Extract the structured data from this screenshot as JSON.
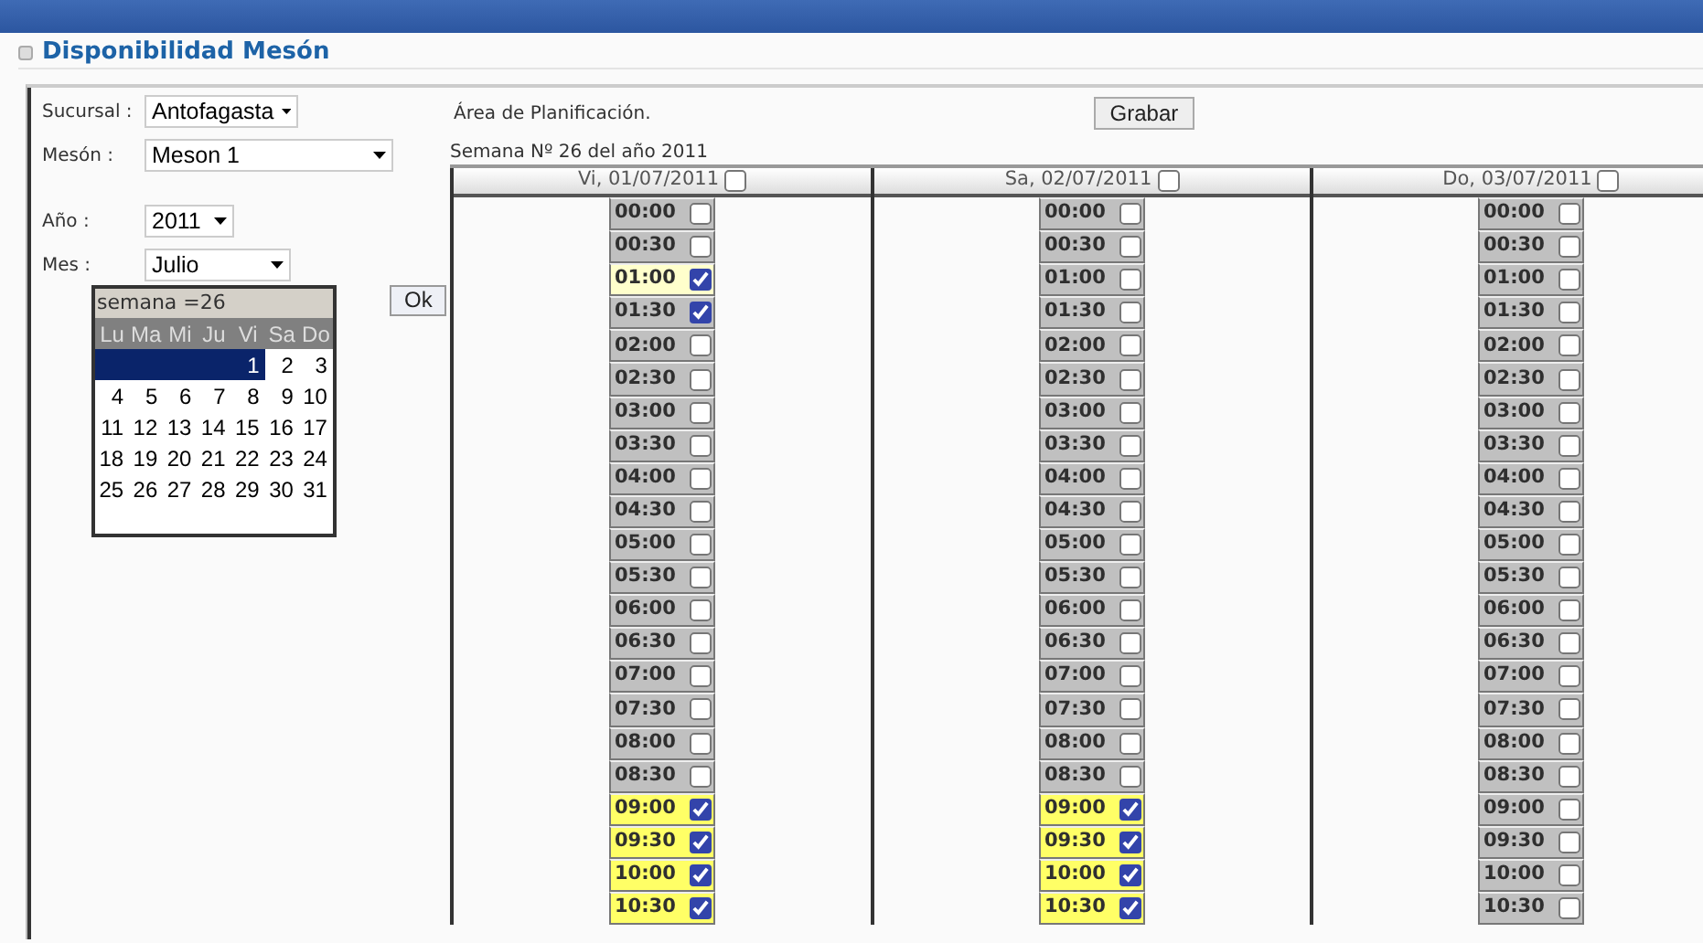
{
  "page_title": "Disponibilidad Mesón",
  "filters": [
    {
      "label": "Sucursal :",
      "value": "Antofagasta"
    },
    {
      "label": "Mesón :",
      "value": "Meson 1"
    },
    {
      "label": "Año :",
      "value": "2011"
    },
    {
      "label": "Mes :",
      "value": "Julio"
    }
  ],
  "calendar": {
    "title": "semana =26",
    "weekdays": [
      "Lu",
      "Ma",
      "Mi",
      "Ju",
      "Vi",
      "Sa",
      "Do"
    ],
    "weeks": [
      {
        "selected": true,
        "days": [
          "1",
          "2",
          "3"
        ]
      },
      {
        "selected": false,
        "days": [
          "4",
          "5",
          "6",
          "7",
          "8",
          "9",
          "10"
        ]
      },
      {
        "selected": false,
        "days": [
          "11",
          "12",
          "13",
          "14",
          "15",
          "16",
          "17"
        ]
      },
      {
        "selected": false,
        "days": [
          "18",
          "19",
          "20",
          "21",
          "22",
          "23",
          "24"
        ]
      },
      {
        "selected": false,
        "days": [
          "25",
          "26",
          "27",
          "28",
          "29",
          "30",
          "31"
        ]
      }
    ]
  },
  "ok_button": "Ok",
  "planning": {
    "title": "Área de Planificación.",
    "save_button": "Grabar",
    "week_label": "Semana Nº 26 del año 2011",
    "days": [
      {
        "header": "Vi, 01/07/2011",
        "checked": false,
        "slots": [
          {
            "time": "00:00",
            "checked": false,
            "selected": false,
            "hovered": false
          },
          {
            "time": "00:30",
            "checked": false,
            "selected": false,
            "hovered": false
          },
          {
            "time": "01:00",
            "checked": true,
            "selected": false,
            "hovered": true
          },
          {
            "time": "01:30",
            "checked": true,
            "selected": false,
            "hovered": false
          },
          {
            "time": "02:00",
            "checked": false,
            "selected": false,
            "hovered": false
          },
          {
            "time": "02:30",
            "checked": false,
            "selected": false,
            "hovered": false
          },
          {
            "time": "03:00",
            "checked": false,
            "selected": false,
            "hovered": false
          },
          {
            "time": "03:30",
            "checked": false,
            "selected": false,
            "hovered": false
          },
          {
            "time": "04:00",
            "checked": false,
            "selected": false,
            "hovered": false
          },
          {
            "time": "04:30",
            "checked": false,
            "selected": false,
            "hovered": false
          },
          {
            "time": "05:00",
            "checked": false,
            "selected": false,
            "hovered": false
          },
          {
            "time": "05:30",
            "checked": false,
            "selected": false,
            "hovered": false
          },
          {
            "time": "06:00",
            "checked": false,
            "selected": false,
            "hovered": false
          },
          {
            "time": "06:30",
            "checked": false,
            "selected": false,
            "hovered": false
          },
          {
            "time": "07:00",
            "checked": false,
            "selected": false,
            "hovered": false
          },
          {
            "time": "07:30",
            "checked": false,
            "selected": false,
            "hovered": false
          },
          {
            "time": "08:00",
            "checked": false,
            "selected": false,
            "hovered": false
          },
          {
            "time": "08:30",
            "checked": false,
            "selected": false,
            "hovered": false
          },
          {
            "time": "09:00",
            "checked": true,
            "selected": true,
            "hovered": false
          },
          {
            "time": "09:30",
            "checked": true,
            "selected": true,
            "hovered": false
          },
          {
            "time": "10:00",
            "checked": true,
            "selected": true,
            "hovered": false
          },
          {
            "time": "10:30",
            "checked": true,
            "selected": true,
            "hovered": false
          }
        ]
      },
      {
        "header": "Sa, 02/07/2011",
        "checked": false,
        "slots": [
          {
            "time": "00:00",
            "checked": false,
            "selected": false,
            "hovered": false
          },
          {
            "time": "00:30",
            "checked": false,
            "selected": false,
            "hovered": false
          },
          {
            "time": "01:00",
            "checked": false,
            "selected": false,
            "hovered": false
          },
          {
            "time": "01:30",
            "checked": false,
            "selected": false,
            "hovered": false
          },
          {
            "time": "02:00",
            "checked": false,
            "selected": false,
            "hovered": false
          },
          {
            "time": "02:30",
            "checked": false,
            "selected": false,
            "hovered": false
          },
          {
            "time": "03:00",
            "checked": false,
            "selected": false,
            "hovered": false
          },
          {
            "time": "03:30",
            "checked": false,
            "selected": false,
            "hovered": false
          },
          {
            "time": "04:00",
            "checked": false,
            "selected": false,
            "hovered": false
          },
          {
            "time": "04:30",
            "checked": false,
            "selected": false,
            "hovered": false
          },
          {
            "time": "05:00",
            "checked": false,
            "selected": false,
            "hovered": false
          },
          {
            "time": "05:30",
            "checked": false,
            "selected": false,
            "hovered": false
          },
          {
            "time": "06:00",
            "checked": false,
            "selected": false,
            "hovered": false
          },
          {
            "time": "06:30",
            "checked": false,
            "selected": false,
            "hovered": false
          },
          {
            "time": "07:00",
            "checked": false,
            "selected": false,
            "hovered": false
          },
          {
            "time": "07:30",
            "checked": false,
            "selected": false,
            "hovered": false
          },
          {
            "time": "08:00",
            "checked": false,
            "selected": false,
            "hovered": false
          },
          {
            "time": "08:30",
            "checked": false,
            "selected": false,
            "hovered": false
          },
          {
            "time": "09:00",
            "checked": true,
            "selected": true,
            "hovered": false
          },
          {
            "time": "09:30",
            "checked": true,
            "selected": true,
            "hovered": false
          },
          {
            "time": "10:00",
            "checked": true,
            "selected": true,
            "hovered": false
          },
          {
            "time": "10:30",
            "checked": true,
            "selected": true,
            "hovered": false
          }
        ]
      },
      {
        "header": "Do, 03/07/2011",
        "checked": false,
        "slots": [
          {
            "time": "00:00",
            "checked": false,
            "selected": false,
            "hovered": false
          },
          {
            "time": "00:30",
            "checked": false,
            "selected": false,
            "hovered": false
          },
          {
            "time": "01:00",
            "checked": false,
            "selected": false,
            "hovered": false
          },
          {
            "time": "01:30",
            "checked": false,
            "selected": false,
            "hovered": false
          },
          {
            "time": "02:00",
            "checked": false,
            "selected": false,
            "hovered": false
          },
          {
            "time": "02:30",
            "checked": false,
            "selected": false,
            "hovered": false
          },
          {
            "time": "03:00",
            "checked": false,
            "selected": false,
            "hovered": false
          },
          {
            "time": "03:30",
            "checked": false,
            "selected": false,
            "hovered": false
          },
          {
            "time": "04:00",
            "checked": false,
            "selected": false,
            "hovered": false
          },
          {
            "time": "04:30",
            "checked": false,
            "selected": false,
            "hovered": false
          },
          {
            "time": "05:00",
            "checked": false,
            "selected": false,
            "hovered": false
          },
          {
            "time": "05:30",
            "checked": false,
            "selected": false,
            "hovered": false
          },
          {
            "time": "06:00",
            "checked": false,
            "selected": false,
            "hovered": false
          },
          {
            "time": "06:30",
            "checked": false,
            "selected": false,
            "hovered": false
          },
          {
            "time": "07:00",
            "checked": false,
            "selected": false,
            "hovered": false
          },
          {
            "time": "07:30",
            "checked": false,
            "selected": false,
            "hovered": false
          },
          {
            "time": "08:00",
            "checked": false,
            "selected": false,
            "hovered": false
          },
          {
            "time": "08:30",
            "checked": false,
            "selected": false,
            "hovered": false
          },
          {
            "time": "09:00",
            "checked": false,
            "selected": false,
            "hovered": false
          },
          {
            "time": "09:30",
            "checked": false,
            "selected": false,
            "hovered": false
          },
          {
            "time": "10:00",
            "checked": false,
            "selected": false,
            "hovered": false
          },
          {
            "time": "10:30",
            "checked": false,
            "selected": false,
            "hovered": false
          }
        ]
      }
    ]
  }
}
